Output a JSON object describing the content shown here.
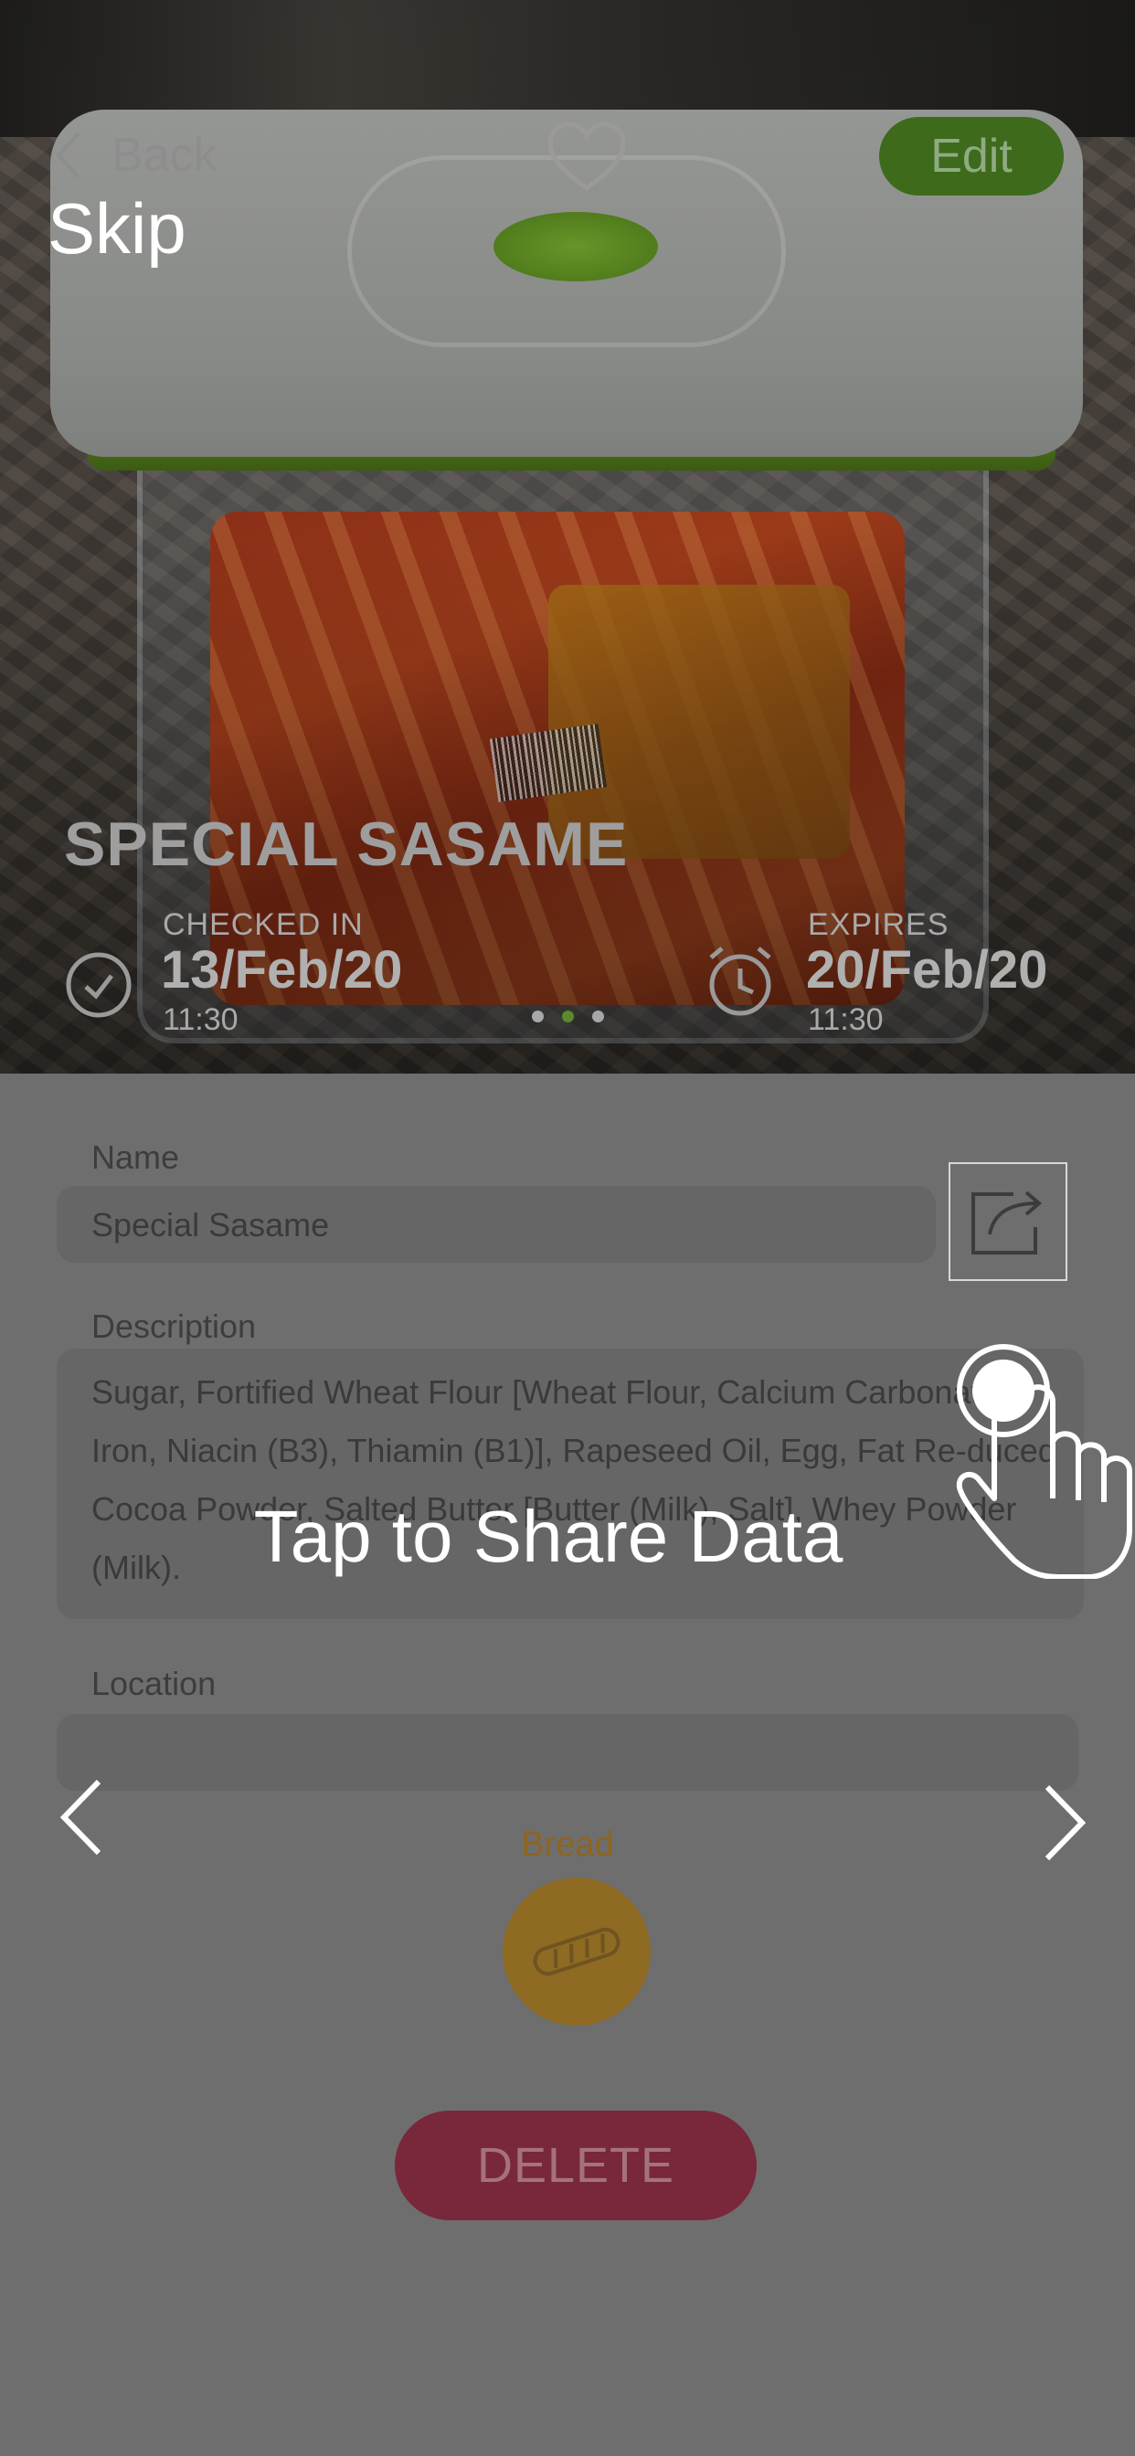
{
  "header": {
    "back_label": "Back",
    "edit_label": "Edit"
  },
  "item": {
    "title": "SPECIAL SASAME",
    "checked_in": {
      "label": "CHECKED IN",
      "date": "13/Feb/20",
      "time": "11:30"
    },
    "expires": {
      "label": "EXPIRES",
      "date": "20/Feb/20",
      "time": "11:30"
    }
  },
  "carousel": {
    "total": 3,
    "active": 2
  },
  "form": {
    "name_label": "Name",
    "name_value": "Special Sasame",
    "description_label": "Description",
    "description_value": "Sugar, Fortified Wheat Flour [Wheat Flour, Calcium Carbonate, Iron, Niacin (B3), Thiamin (B1)], Rapeseed Oil, Egg, Fat Re-duced Cocoa Powder, Salted Butter [Butter (Milk), Salt], Whey Powder (Milk).",
    "location_label": "Location",
    "location_value": ""
  },
  "category": {
    "label": "Bread",
    "icon": "bread-icon"
  },
  "delete_label": "DELETE",
  "overlay": {
    "skip_label": "Skip",
    "tip_text": "Tap to Share Data"
  },
  "colors": {
    "accent_green": "#3e6a1c",
    "delete_red": "#78283a",
    "category_gold": "#8e6a23"
  }
}
